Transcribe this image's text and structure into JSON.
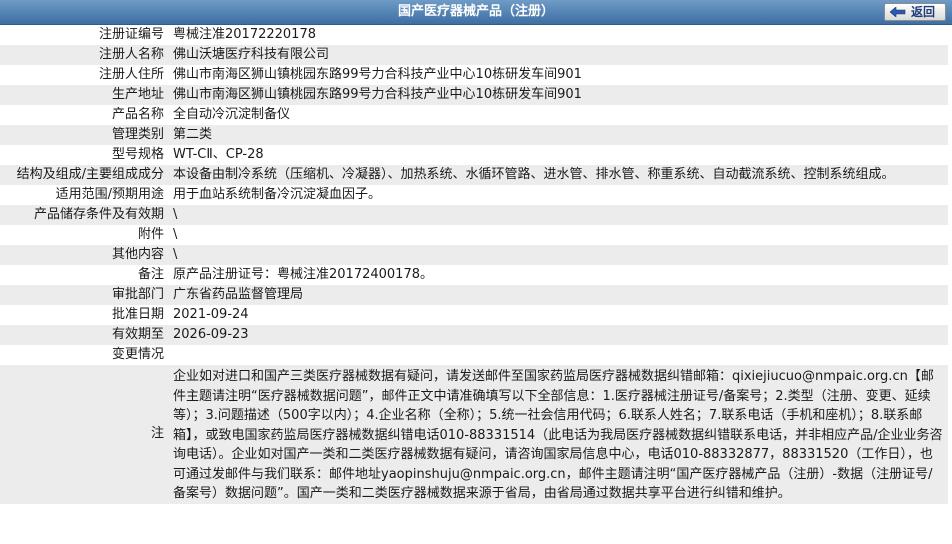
{
  "header": {
    "title": "国产医疗器械产品（注册）",
    "back_label": "返回"
  },
  "rows": [
    {
      "label": "注册证编号",
      "value": "粤械注准20172220178"
    },
    {
      "label": "注册人名称",
      "value": "佛山沃塘医疗科技有限公司"
    },
    {
      "label": "注册人住所",
      "value": "佛山市南海区狮山镇桃园东路99号力合科技产业中心10栋研发车间901"
    },
    {
      "label": "生产地址",
      "value": "佛山市南海区狮山镇桃园东路99号力合科技产业中心10栋研发车间901"
    },
    {
      "label": "产品名称",
      "value": "全自动冷沉淀制备仪"
    },
    {
      "label": "管理类别",
      "value": "第二类"
    },
    {
      "label": "型号规格",
      "value": "WT-CⅡ、CP-28"
    },
    {
      "label": "结构及组成/主要组成成分",
      "value": "本设备由制冷系统（压缩机、冷凝器）、加热系统、水循环管路、进水管、排水管、称重系统、自动截流系统、控制系统组成。"
    },
    {
      "label": "适用范围/预期用途",
      "value": "用于血站系统制备冷沉淀凝血因子。"
    },
    {
      "label": "产品储存条件及有效期",
      "value": "\\"
    },
    {
      "label": "附件",
      "value": "\\"
    },
    {
      "label": "其他内容",
      "value": "\\"
    },
    {
      "label": "备注",
      "value": "原产品注册证号：粤械注准20172400178。"
    },
    {
      "label": "审批部门",
      "value": "广东省药品监督管理局"
    },
    {
      "label": "批准日期",
      "value": "2021-09-24"
    },
    {
      "label": "有效期至",
      "value": "2026-09-23"
    },
    {
      "label": "变更情况",
      "value": ""
    }
  ],
  "note": {
    "label": "注",
    "text": "企业如对进口和国产三类医疗器械数据有疑问，请发送邮件至国家药监局医疗器械数据纠错邮箱：qixiejiucuo@nmpaic.org.cn【邮件主题请注明“医疗器械数据问题”，邮件正文中请准确填写以下全部信息：1.医疗器械注册证号/备案号；2.类型（注册、变更、延续等）；3.问题描述（500字以内）；4.企业名称（全称）；5.统一社会信用代码；6.联系人姓名；7.联系电话（手机和座机）；8.联系邮箱】，或致电国家药监局医疗器械数据纠错电话010-88331514（此电话为我局医疗器械数据纠错联系电话，并非相应产品/企业业务咨询电话）。企业如对国产一类和二类医疗器械数据有疑问，请咨询国家局信息中心，电话010-88332877，88331520（工作日），也可通过发邮件与我们联系：邮件地址yaopinshuju@nmpaic.org.cn，邮件主题请注明“国产医疗器械产品（注册）-数据（注册证号/备案号）数据问题”。国产一类和二类医疗器械数据来源于省局，由省局通过数据共享平台进行纠错和维护。"
  }
}
